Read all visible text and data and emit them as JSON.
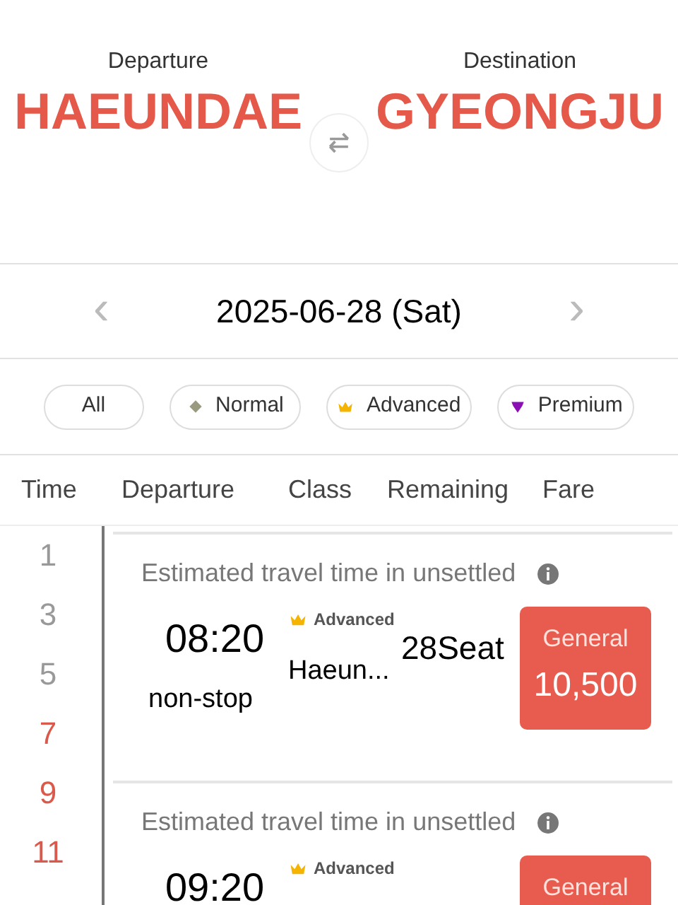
{
  "route": {
    "departure_label": "Departure",
    "departure": "HAEUNDAE",
    "destination_label": "Destination",
    "destination": "GYEONGJU"
  },
  "date": {
    "text": "2025-06-28 (Sat)",
    "prev": "‹",
    "next": "›"
  },
  "filters": [
    {
      "label": "All",
      "kind": "all"
    },
    {
      "label": "Normal",
      "kind": "normal"
    },
    {
      "label": "Advanced",
      "kind": "advanced"
    },
    {
      "label": "Premium",
      "kind": "premium"
    }
  ],
  "columns": [
    "Time",
    "Departure",
    "Class",
    "Remaining",
    "Fare"
  ],
  "hours": [
    {
      "label": "1",
      "available": false
    },
    {
      "label": "3",
      "available": false
    },
    {
      "label": "5",
      "available": false
    },
    {
      "label": "7",
      "available": true
    },
    {
      "label": "9",
      "available": true
    },
    {
      "label": "11",
      "available": true
    }
  ],
  "trips": [
    {
      "note": "Estimated travel time in unsettled",
      "time": "08:20",
      "route_type": "non-stop",
      "class": "Advanced",
      "kind": "advanced",
      "origin": "Haeun...",
      "seats": "28Seat",
      "fare_type": "General",
      "fare": "10,500"
    },
    {
      "note": "Estimated travel time in unsettled",
      "time": "09:20",
      "class": "Advanced",
      "kind": "advanced",
      "fare_type": "General"
    }
  ]
}
